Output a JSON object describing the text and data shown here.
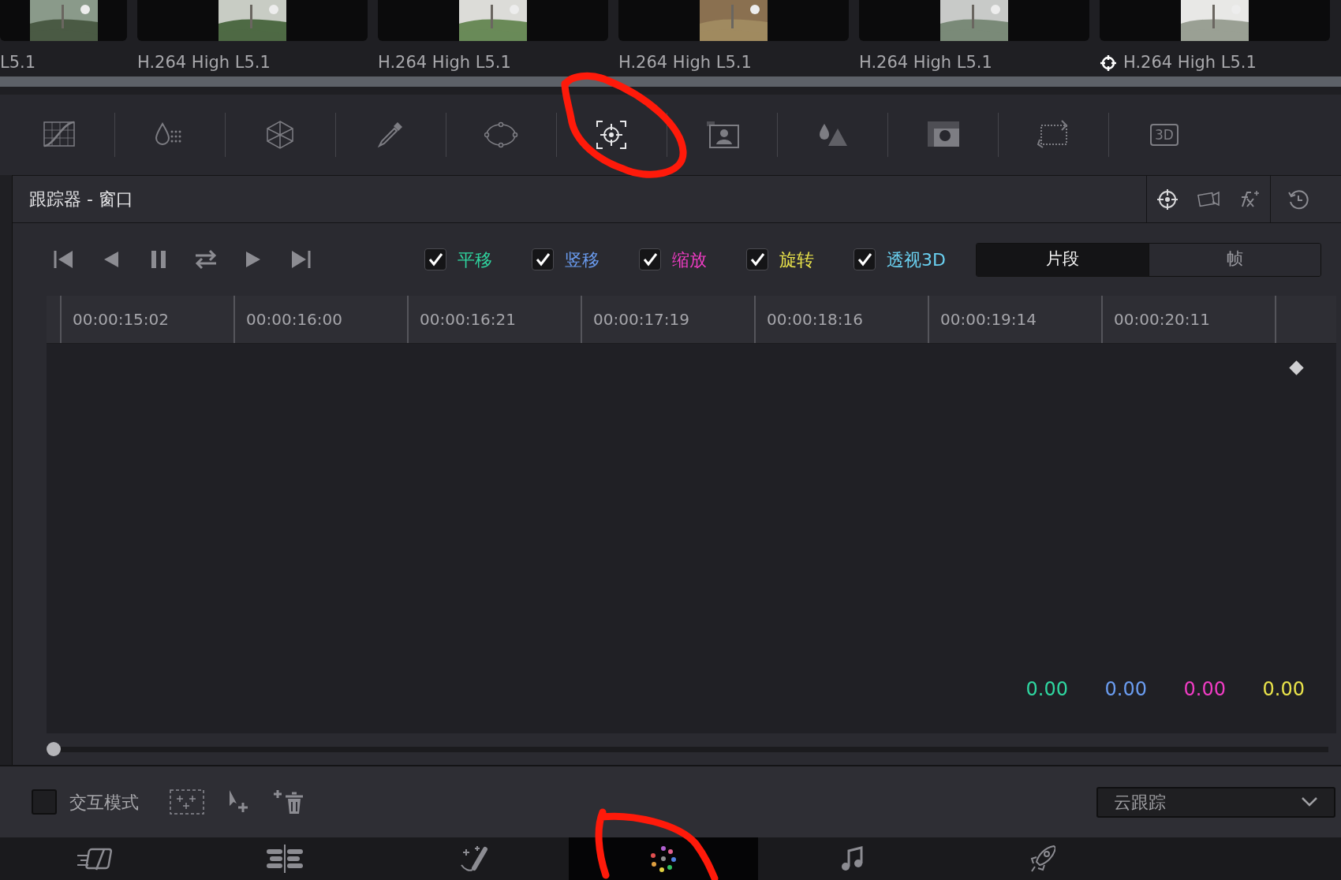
{
  "clips": [
    {
      "label": "L5.1",
      "tracked": false,
      "kind": "picture"
    },
    {
      "label": "H.264 High L5.1",
      "tracked": false,
      "kind": "picture"
    },
    {
      "label": "H.264 High L5.1",
      "tracked": false,
      "kind": "picture"
    },
    {
      "label": "H.264 High L5.1",
      "tracked": false,
      "kind": "picture"
    },
    {
      "label": "H.264 High L5.1",
      "tracked": false,
      "kind": "picture"
    },
    {
      "label": "H.264 High L5.1",
      "tracked": true,
      "kind": "picture"
    }
  ],
  "palette_tools": [
    {
      "kind": "curves",
      "selected": false
    },
    {
      "kind": "qualifier",
      "selected": false
    },
    {
      "kind": "warper",
      "selected": false
    },
    {
      "kind": "picker",
      "selected": false
    },
    {
      "kind": "window",
      "selected": false
    },
    {
      "kind": "tracker",
      "selected": true
    },
    {
      "kind": "magicmask",
      "selected": false
    },
    {
      "kind": "blur",
      "selected": false
    },
    {
      "kind": "key",
      "selected": false
    },
    {
      "kind": "sizing",
      "selected": false
    },
    {
      "kind": "stereo",
      "selected": false,
      "label": "3D"
    }
  ],
  "panel": {
    "title": "跟踪器 - 窗口"
  },
  "header_tools": [
    {
      "kind": "crosshair"
    },
    {
      "kind": "camera"
    },
    {
      "kind": "fx"
    },
    {
      "kind": "reset"
    }
  ],
  "transport": [
    {
      "kind": "first"
    },
    {
      "kind": "prev"
    },
    {
      "kind": "pause"
    },
    {
      "kind": "loop"
    },
    {
      "kind": "next"
    },
    {
      "kind": "last"
    }
  ],
  "track_options": [
    {
      "label": "平移",
      "checked": true,
      "color": "#2fd6a0"
    },
    {
      "label": "竖移",
      "checked": true,
      "color": "#6a9cf0"
    },
    {
      "label": "缩放",
      "checked": true,
      "color": "#f03cc4"
    },
    {
      "label": "旋转",
      "checked": true,
      "color": "#e8e24a"
    },
    {
      "label": "透视3D",
      "checked": true,
      "color": "#6ad0f0"
    }
  ],
  "mode_tabs": [
    {
      "label": "片段",
      "selected": true
    },
    {
      "label": "帧",
      "selected": false
    }
  ],
  "timecodes": [
    "00:00:15:02",
    "00:00:16:00",
    "00:00:16:21",
    "00:00:17:19",
    "00:00:18:16",
    "00:00:19:14",
    "00:00:20:11"
  ],
  "readouts": [
    {
      "value": "0.00",
      "color": "#2fd6a0"
    },
    {
      "value": "0.00",
      "color": "#6a9cf0"
    },
    {
      "value": "0.00",
      "color": "#f03cc4"
    },
    {
      "value": "0.00",
      "color": "#e8e24a"
    }
  ],
  "interactive_mode": {
    "label": "交互模式",
    "checked": false
  },
  "bottom_tools": [
    {
      "kind": "addpoints"
    },
    {
      "kind": "pointer"
    },
    {
      "kind": "deletepoints"
    }
  ],
  "tracker_type": {
    "value": "云跟踪"
  },
  "page_nav": [
    {
      "kind": "cut",
      "selected": false
    },
    {
      "kind": "edit",
      "selected": false
    },
    {
      "kind": "fusion",
      "selected": false
    },
    {
      "kind": "color",
      "selected": true
    },
    {
      "kind": "fairlight",
      "selected": false
    },
    {
      "kind": "deliver",
      "selected": false
    }
  ]
}
